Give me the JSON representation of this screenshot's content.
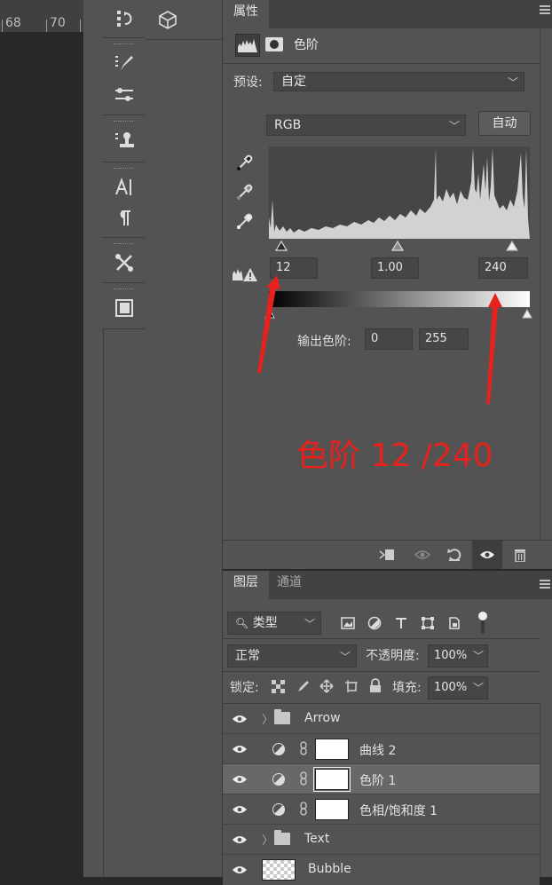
{
  "ruler": {
    "marks": [
      "68",
      "70"
    ]
  },
  "properties": {
    "tab_label": "属性",
    "adjustment_title": "色阶",
    "preset_label": "预设:",
    "preset_value": "自定",
    "channel_value": "RGB",
    "auto_button": "自动",
    "input_black": "12",
    "input_gamma": "1.00",
    "input_white": "240",
    "output_label": "输出色阶:",
    "output_black": "0",
    "output_white": "255"
  },
  "annotation": {
    "text": "色阶 12 /240",
    "color": "#e8211c"
  },
  "layers_panel": {
    "tabs": [
      "图层",
      "通道"
    ],
    "filter_value": "类型",
    "blend_mode": "正常",
    "opacity_label": "不透明度:",
    "opacity_value": "100%",
    "lock_label": "锁定:",
    "fill_label": "填充:",
    "fill_value": "100%",
    "layers": [
      {
        "name": "Arrow",
        "kind": "group"
      },
      {
        "name": "曲线 2",
        "kind": "adjustment"
      },
      {
        "name": "色阶 1",
        "kind": "adjustment",
        "selected": true
      },
      {
        "name": "色相/饱和度 1",
        "kind": "adjustment"
      },
      {
        "name": "Text",
        "kind": "group"
      },
      {
        "name": "Bubble",
        "kind": "pixel"
      }
    ]
  },
  "colors": {
    "panel": "#535353",
    "selected_row": "#686868",
    "annotation": "#e8211c"
  }
}
